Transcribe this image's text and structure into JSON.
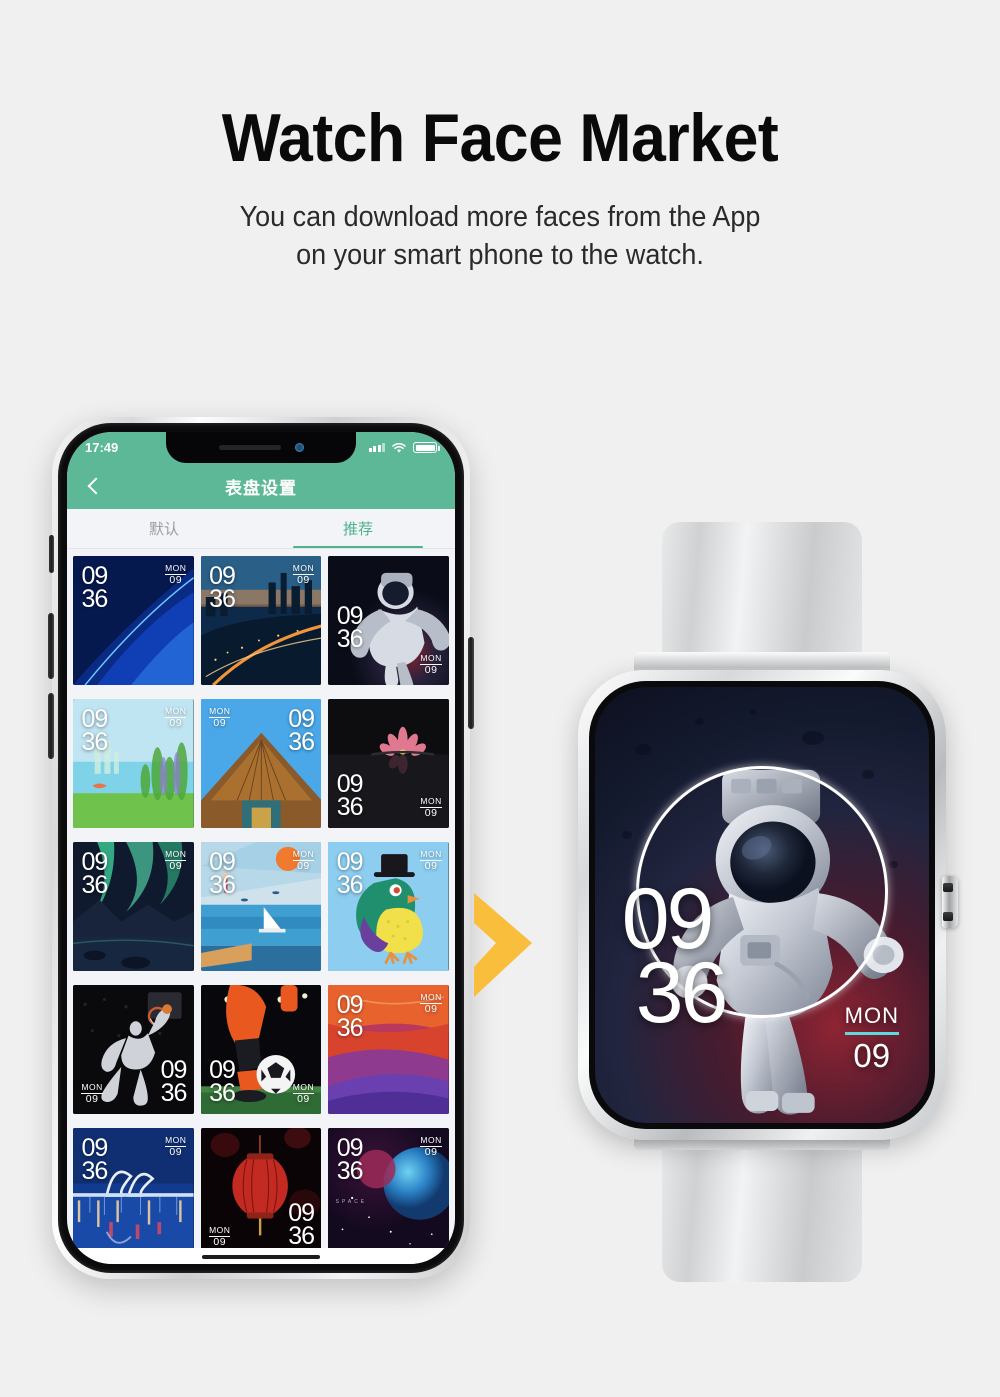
{
  "hero": {
    "title": "Watch Face Market",
    "subtitle_line1": "You can download more faces from the App",
    "subtitle_line2": "on your smart phone to the watch."
  },
  "colors": {
    "page_background": "#f0f0f0",
    "app_accent_green": "#5cb896",
    "tab_active_green": "#4eb28d",
    "arrow_orange": "#fabe3d",
    "watch_date_underline": "#5fd9e0"
  },
  "phone": {
    "status_bar": {
      "time": "17:49",
      "signal_icon": "signal-dots-icon",
      "wifi_icon": "wifi-icon",
      "battery_icon": "battery-full-icon"
    },
    "nav_bar": {
      "back_icon": "chevron-left-icon",
      "title": "表盘设置"
    },
    "tabs": [
      {
        "label": "默认",
        "active": false
      },
      {
        "label": "推荐",
        "active": true
      }
    ],
    "watch_faces": [
      {
        "id": 1,
        "name": "blue-abstract-waves",
        "hour": "09",
        "minute": "36",
        "dow": "MON",
        "day": "09",
        "time_pos": "top-left",
        "date_pos": "top-right"
      },
      {
        "id": 2,
        "name": "city-night-skyline",
        "hour": "09",
        "minute": "36",
        "dow": "MON",
        "day": "09",
        "time_pos": "top-left",
        "date_pos": "top-right"
      },
      {
        "id": 3,
        "name": "astronaut-space",
        "hour": "09",
        "minute": "36",
        "dow": "MON",
        "day": "09",
        "time_pos": "mid-left",
        "date_pos": "bottom-right"
      },
      {
        "id": 4,
        "name": "green-fantasy-landscape",
        "hour": "09",
        "minute": "36",
        "dow": "MON",
        "day": "09",
        "time_pos": "top-left",
        "date_pos": "top-right"
      },
      {
        "id": 5,
        "name": "temple-roof-blue-sky",
        "hour": "09",
        "minute": "36",
        "dow": "MON",
        "day": "09",
        "time_pos": "top-right",
        "date_pos": "top-left"
      },
      {
        "id": 6,
        "name": "lotus-flower-dark",
        "hour": "09",
        "minute": "36",
        "dow": "MON",
        "day": "09",
        "time_pos": "bottom-left",
        "date_pos": "bottom-right"
      },
      {
        "id": 7,
        "name": "aurora-borealis",
        "hour": "09",
        "minute": "36",
        "dow": "MON",
        "day": "09",
        "time_pos": "top-left",
        "date_pos": "top-right"
      },
      {
        "id": 8,
        "name": "sailboat-illustration",
        "hour": "09",
        "minute": "36",
        "dow": "MON",
        "day": "09",
        "time_pos": "top-left",
        "date_pos": "top-right"
      },
      {
        "id": 9,
        "name": "bird-with-hat-art",
        "hour": "09",
        "minute": "36",
        "dow": "MON",
        "day": "09",
        "time_pos": "top-left",
        "date_pos": "top-right"
      },
      {
        "id": 10,
        "name": "basketball-dunk",
        "hour": "09",
        "minute": "36",
        "dow": "MON",
        "day": "09",
        "time_pos": "bottom-right",
        "date_pos": "bottom-left"
      },
      {
        "id": 11,
        "name": "soccer-player-ball",
        "hour": "09",
        "minute": "36",
        "dow": "MON",
        "day": "09",
        "time_pos": "bottom-left",
        "date_pos": "bottom-right"
      },
      {
        "id": 12,
        "name": "canyon-orange-purple",
        "hour": "09",
        "minute": "36",
        "dow": "MON",
        "day": "09",
        "time_pos": "top-left",
        "date_pos": "top-right"
      },
      {
        "id": 13,
        "name": "bridge-night-reflection",
        "hour": "09",
        "minute": "36",
        "dow": "MON",
        "day": "09",
        "time_pos": "top-left",
        "date_pos": "top-right"
      },
      {
        "id": 14,
        "name": "red-lantern-dark",
        "hour": "09",
        "minute": "36",
        "dow": "MON",
        "day": "09",
        "time_pos": "bottom-right",
        "date_pos": "bottom-left"
      },
      {
        "id": 15,
        "name": "planet-deep-space",
        "hour": "09",
        "minute": "36",
        "dow": "MON",
        "day": "09",
        "time_pos": "top-left",
        "date_pos": "top-right",
        "caption": "SPACE"
      }
    ]
  },
  "arrow": {
    "icon": "chevron-right-arrow",
    "label": ""
  },
  "watch": {
    "face_name": "astronaut-space",
    "hour": "09",
    "minute": "36",
    "dow": "MON",
    "day": "09",
    "crown_icon": "watch-crown-icon"
  }
}
